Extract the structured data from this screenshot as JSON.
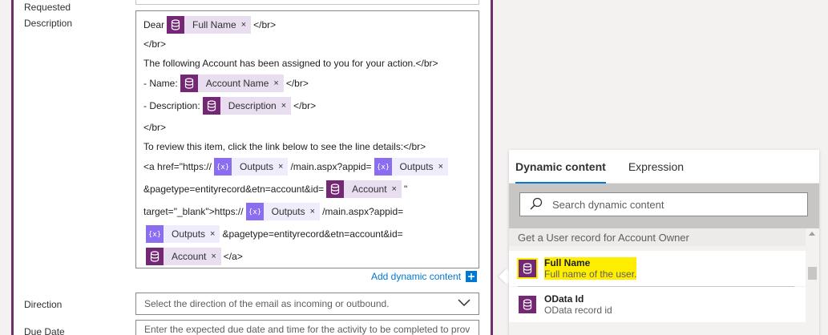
{
  "form": {
    "requested_label": "Requested",
    "description_label": "Description",
    "direction_label": "Direction",
    "due_date_label": "Due Date",
    "direction_placeholder": "Select the direction of the email as incoming or outbound.",
    "due_date_placeholder": "Enter the expected due date and time for the activity to be completed to prov",
    "add_dynamic_content": "Add dynamic content"
  },
  "editor": {
    "l1_a": "Dear",
    "l1_b": "</br>",
    "l2": "</br>",
    "l3": "The following Account has been assigned to you for your action.</br>",
    "l4_a": "- Name:",
    "l4_b": "</br>",
    "l5_a": "- Description:",
    "l5_b": "</br>",
    "l6": "</br>",
    "l7": "To review this item, click the link below to see the line details:</br>",
    "l8_a": "<a href=\"https://",
    "l8_b": "/main.aspx?appid=",
    "l9_a": "&pagetype=entityrecord&etn=account&id=",
    "l9_b": "\"",
    "l10_a": "target=\"_blank\">https://",
    "l10_b": "/main.aspx?appid=",
    "l11_a": "&pagetype=entityrecord&etn=account&id=",
    "l12_a": "</a>"
  },
  "tokens": {
    "full_name": "Full Name",
    "account_name": "Account Name",
    "description": "Description",
    "outputs": "Outputs",
    "account": "Account",
    "remove": "×"
  },
  "panel": {
    "tab_dynamic": "Dynamic content",
    "tab_expression": "Expression",
    "search_placeholder": "Search dynamic content",
    "group_header": "Get a User record for Account Owner",
    "items": [
      {
        "name": "Full Name",
        "desc": "Full name of the user."
      },
      {
        "name": "OData Id",
        "desc": "OData record id"
      }
    ]
  },
  "colors": {
    "dataverse": "#742774",
    "outputs": "#8a6df0",
    "accent": "#0078d4",
    "highlight": "#ffee00"
  }
}
